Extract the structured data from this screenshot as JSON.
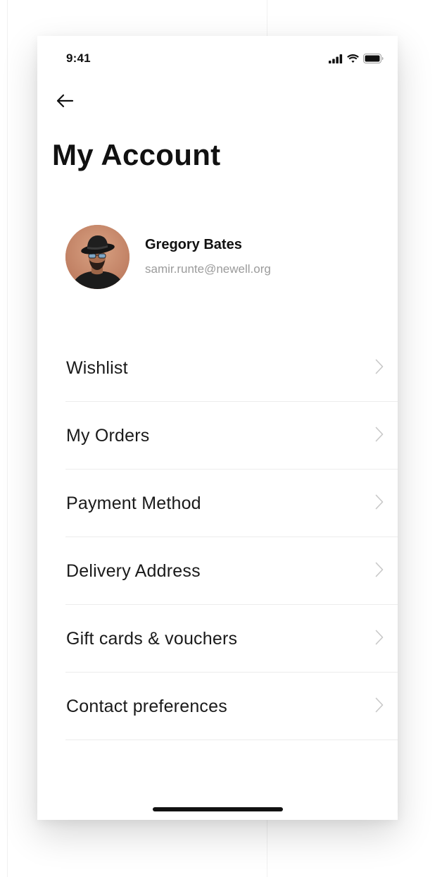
{
  "status_bar": {
    "time": "9:41",
    "icons": [
      "signal-icon",
      "wifi-icon",
      "battery-icon"
    ]
  },
  "header": {
    "back_icon": "arrow-left-icon",
    "title": "My Account"
  },
  "profile": {
    "name": "Gregory Bates",
    "email": "samir.runte@newell.org"
  },
  "menu": {
    "items": [
      {
        "label": "Wishlist"
      },
      {
        "label": "My Orders"
      },
      {
        "label": "Payment Method"
      },
      {
        "label": "Delivery Address"
      },
      {
        "label": "Gift cards & vouchers"
      },
      {
        "label": "Contact preferences"
      }
    ],
    "chevron_icon": "chevron-right-icon"
  },
  "colors": {
    "text_primary": "#111111",
    "text_secondary": "#9b9b9b",
    "divider": "#ececec",
    "chevron": "#c8c8c8"
  }
}
